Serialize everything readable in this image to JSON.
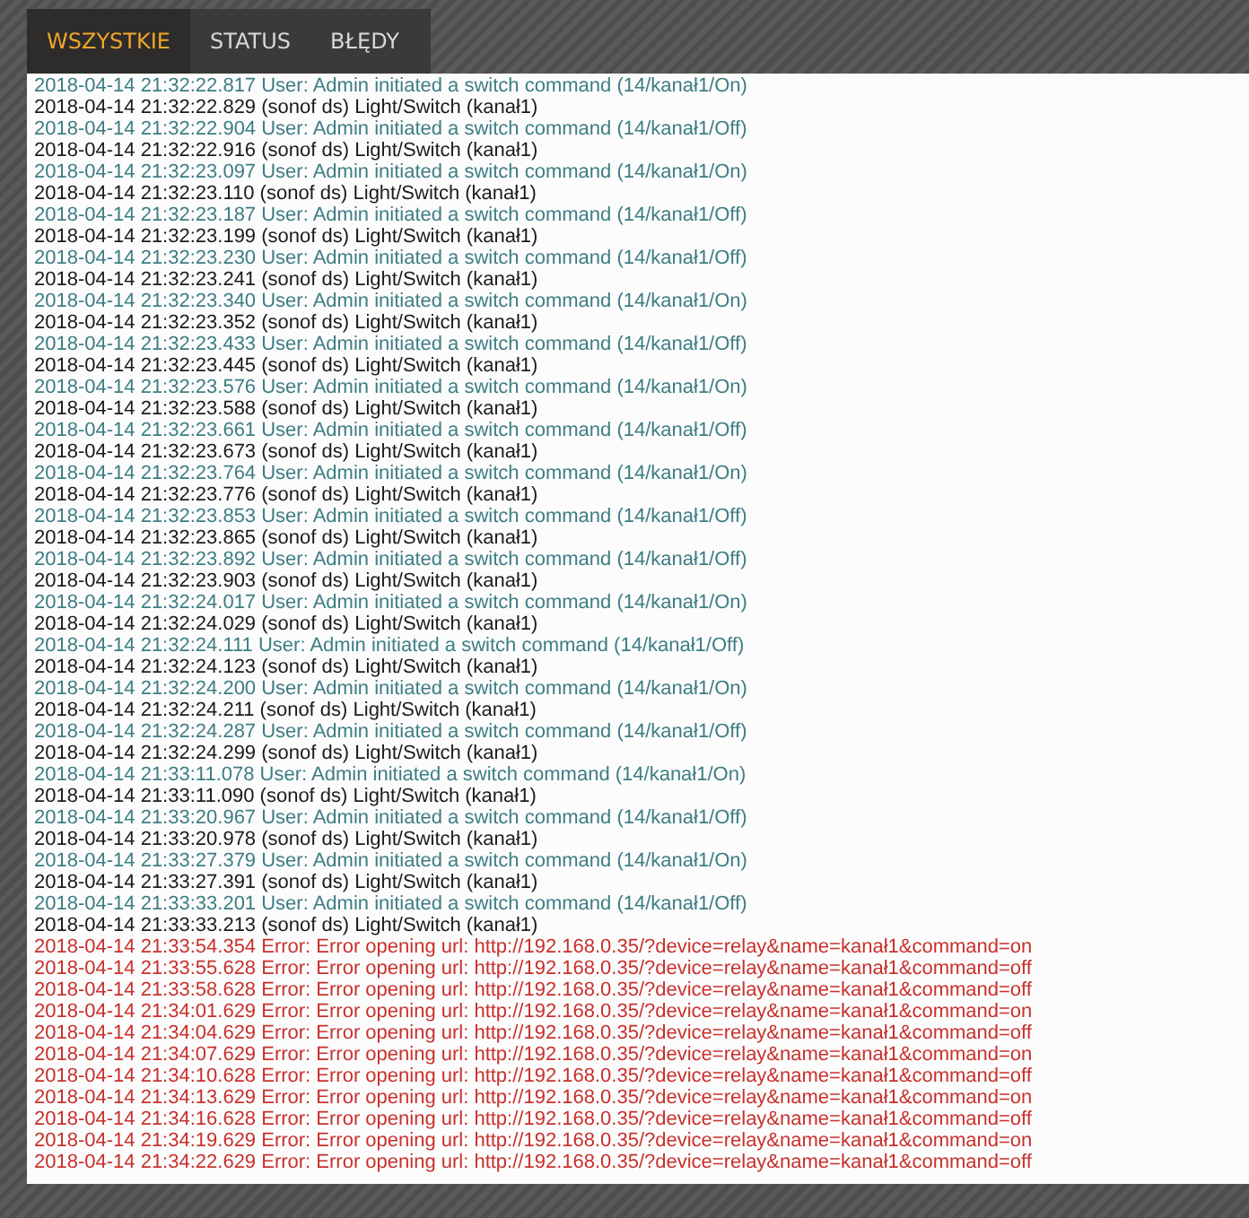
{
  "tabs": [
    {
      "label": "WSZYSTKIE",
      "selected": true
    },
    {
      "label": "STATUS",
      "selected": false
    },
    {
      "label": "BŁĘDY",
      "selected": false
    }
  ],
  "log": [
    {
      "kind": "user",
      "text": "2018-04-14 21:32:22.817 User: Admin initiated a switch command (14/kanał1/On)"
    },
    {
      "kind": "device",
      "text": "2018-04-14 21:32:22.829 (sonof ds) Light/Switch (kanał1)"
    },
    {
      "kind": "user",
      "text": "2018-04-14 21:32:22.904 User: Admin initiated a switch command (14/kanał1/Off)"
    },
    {
      "kind": "device",
      "text": "2018-04-14 21:32:22.916 (sonof ds) Light/Switch (kanał1)"
    },
    {
      "kind": "user",
      "text": "2018-04-14 21:32:23.097 User: Admin initiated a switch command (14/kanał1/On)"
    },
    {
      "kind": "device",
      "text": "2018-04-14 21:32:23.110 (sonof ds) Light/Switch (kanał1)"
    },
    {
      "kind": "user",
      "text": "2018-04-14 21:32:23.187 User: Admin initiated a switch command (14/kanał1/Off)"
    },
    {
      "kind": "device",
      "text": "2018-04-14 21:32:23.199 (sonof ds) Light/Switch (kanał1)"
    },
    {
      "kind": "user",
      "text": "2018-04-14 21:32:23.230 User: Admin initiated a switch command (14/kanał1/Off)"
    },
    {
      "kind": "device",
      "text": "2018-04-14 21:32:23.241 (sonof ds) Light/Switch (kanał1)"
    },
    {
      "kind": "user",
      "text": "2018-04-14 21:32:23.340 User: Admin initiated a switch command (14/kanał1/On)"
    },
    {
      "kind": "device",
      "text": "2018-04-14 21:32:23.352 (sonof ds) Light/Switch (kanał1)"
    },
    {
      "kind": "user",
      "text": "2018-04-14 21:32:23.433 User: Admin initiated a switch command (14/kanał1/Off)"
    },
    {
      "kind": "device",
      "text": "2018-04-14 21:32:23.445 (sonof ds) Light/Switch (kanał1)"
    },
    {
      "kind": "user",
      "text": "2018-04-14 21:32:23.576 User: Admin initiated a switch command (14/kanał1/On)"
    },
    {
      "kind": "device",
      "text": "2018-04-14 21:32:23.588 (sonof ds) Light/Switch (kanał1)"
    },
    {
      "kind": "user",
      "text": "2018-04-14 21:32:23.661 User: Admin initiated a switch command (14/kanał1/Off)"
    },
    {
      "kind": "device",
      "text": "2018-04-14 21:32:23.673 (sonof ds) Light/Switch (kanał1)"
    },
    {
      "kind": "user",
      "text": "2018-04-14 21:32:23.764 User: Admin initiated a switch command (14/kanał1/On)"
    },
    {
      "kind": "device",
      "text": "2018-04-14 21:32:23.776 (sonof ds) Light/Switch (kanał1)"
    },
    {
      "kind": "user",
      "text": "2018-04-14 21:32:23.853 User: Admin initiated a switch command (14/kanał1/Off)"
    },
    {
      "kind": "device",
      "text": "2018-04-14 21:32:23.865 (sonof ds) Light/Switch (kanał1)"
    },
    {
      "kind": "user",
      "text": "2018-04-14 21:32:23.892 User: Admin initiated a switch command (14/kanał1/Off)"
    },
    {
      "kind": "device",
      "text": "2018-04-14 21:32:23.903 (sonof ds) Light/Switch (kanał1)"
    },
    {
      "kind": "user",
      "text": "2018-04-14 21:32:24.017 User: Admin initiated a switch command (14/kanał1/On)"
    },
    {
      "kind": "device",
      "text": "2018-04-14 21:32:24.029 (sonof ds) Light/Switch (kanał1)"
    },
    {
      "kind": "user",
      "text": "2018-04-14 21:32:24.111 User: Admin initiated a switch command (14/kanał1/Off)"
    },
    {
      "kind": "device",
      "text": "2018-04-14 21:32:24.123 (sonof ds) Light/Switch (kanał1)"
    },
    {
      "kind": "user",
      "text": "2018-04-14 21:32:24.200 User: Admin initiated a switch command (14/kanał1/On)"
    },
    {
      "kind": "device",
      "text": "2018-04-14 21:32:24.211 (sonof ds) Light/Switch (kanał1)"
    },
    {
      "kind": "user",
      "text": "2018-04-14 21:32:24.287 User: Admin initiated a switch command (14/kanał1/Off)"
    },
    {
      "kind": "device",
      "text": "2018-04-14 21:32:24.299 (sonof ds) Light/Switch (kanał1)"
    },
    {
      "kind": "user",
      "text": "2018-04-14 21:33:11.078 User: Admin initiated a switch command (14/kanał1/On)"
    },
    {
      "kind": "device",
      "text": "2018-04-14 21:33:11.090 (sonof ds) Light/Switch (kanał1)"
    },
    {
      "kind": "user",
      "text": "2018-04-14 21:33:20.967 User: Admin initiated a switch command (14/kanał1/Off)"
    },
    {
      "kind": "device",
      "text": "2018-04-14 21:33:20.978 (sonof ds) Light/Switch (kanał1)"
    },
    {
      "kind": "user",
      "text": "2018-04-14 21:33:27.379 User: Admin initiated a switch command (14/kanał1/On)"
    },
    {
      "kind": "device",
      "text": "2018-04-14 21:33:27.391 (sonof ds) Light/Switch (kanał1)"
    },
    {
      "kind": "user",
      "text": "2018-04-14 21:33:33.201 User: Admin initiated a switch command (14/kanał1/Off)"
    },
    {
      "kind": "device",
      "text": "2018-04-14 21:33:33.213 (sonof ds) Light/Switch (kanał1)"
    },
    {
      "kind": "error",
      "text": "2018-04-14 21:33:54.354 Error: Error opening url: http://192.168.0.35/?device=relay&name=kanał1&command=on"
    },
    {
      "kind": "error",
      "text": "2018-04-14 21:33:55.628 Error: Error opening url: http://192.168.0.35/?device=relay&name=kanał1&command=off"
    },
    {
      "kind": "error",
      "text": "2018-04-14 21:33:58.628 Error: Error opening url: http://192.168.0.35/?device=relay&name=kanał1&command=off"
    },
    {
      "kind": "error",
      "text": "2018-04-14 21:34:01.629 Error: Error opening url: http://192.168.0.35/?device=relay&name=kanał1&command=on"
    },
    {
      "kind": "error",
      "text": "2018-04-14 21:34:04.629 Error: Error opening url: http://192.168.0.35/?device=relay&name=kanał1&command=off"
    },
    {
      "kind": "error",
      "text": "2018-04-14 21:34:07.629 Error: Error opening url: http://192.168.0.35/?device=relay&name=kanał1&command=on"
    },
    {
      "kind": "error",
      "text": "2018-04-14 21:34:10.628 Error: Error opening url: http://192.168.0.35/?device=relay&name=kanał1&command=off"
    },
    {
      "kind": "error",
      "text": "2018-04-14 21:34:13.629 Error: Error opening url: http://192.168.0.35/?device=relay&name=kanał1&command=on"
    },
    {
      "kind": "error",
      "text": "2018-04-14 21:34:16.628 Error: Error opening url: http://192.168.0.35/?device=relay&name=kanał1&command=off"
    },
    {
      "kind": "error",
      "text": "2018-04-14 21:34:19.629 Error: Error opening url: http://192.168.0.35/?device=relay&name=kanał1&command=on"
    },
    {
      "kind": "error",
      "text": "2018-04-14 21:34:22.629 Error: Error opening url: http://192.168.0.35/?device=relay&name=kanał1&command=off"
    }
  ]
}
